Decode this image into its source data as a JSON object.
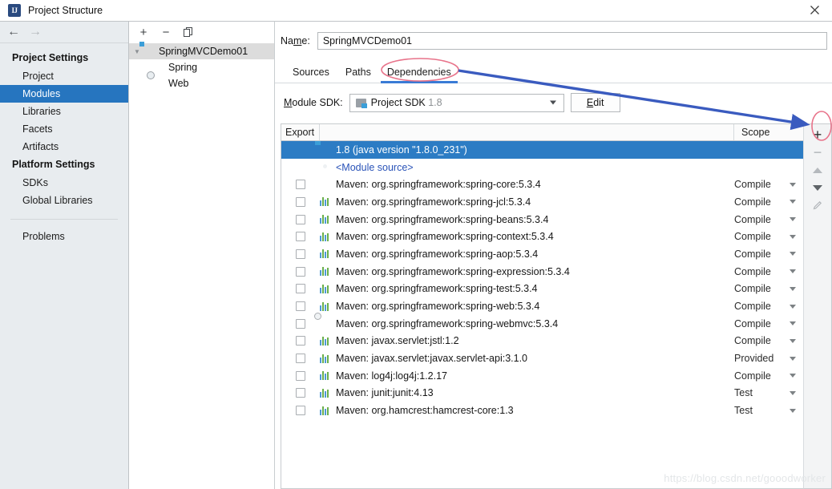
{
  "window": {
    "title": "Project Structure",
    "app_icon": "IJ",
    "close_label": "close-icon"
  },
  "navigation": {
    "back": "←",
    "forward": "→"
  },
  "sidebar": {
    "groups": [
      {
        "heading": "Project Settings",
        "items": [
          {
            "label": "Project",
            "selected": false
          },
          {
            "label": "Modules",
            "selected": true
          },
          {
            "label": "Libraries",
            "selected": false
          },
          {
            "label": "Facets",
            "selected": false
          },
          {
            "label": "Artifacts",
            "selected": false
          }
        ]
      },
      {
        "heading": "Platform Settings",
        "items": [
          {
            "label": "SDKs",
            "selected": false
          },
          {
            "label": "Global Libraries",
            "selected": false
          }
        ]
      }
    ],
    "footer_item": "Problems"
  },
  "module_tree": {
    "toolbar": {
      "add": "+",
      "remove": "−",
      "copy": "❐"
    },
    "nodes": [
      {
        "label": "SpringMVCDemo01",
        "icon": "module-icon",
        "level": 0,
        "selected": true,
        "expanded": true
      },
      {
        "label": "Spring",
        "icon": "spring-leaf-icon",
        "level": 1,
        "selected": false
      },
      {
        "label": "Web",
        "icon": "web-icon",
        "level": 1,
        "selected": false
      }
    ]
  },
  "module_editor": {
    "name_label": "Name:",
    "name_value": "SpringMVCDemo01",
    "tabs": [
      {
        "label": "Sources",
        "active": false
      },
      {
        "label": "Paths",
        "active": false
      },
      {
        "label": "Dependencies",
        "active": true
      }
    ],
    "sdk_label": "Module SDK:",
    "sdk_value": "Project SDK",
    "sdk_value_dim": "1.8",
    "edit_button": "Edit"
  },
  "dependencies_table": {
    "columns": {
      "export": "Export",
      "name": "",
      "scope": "Scope"
    },
    "rows": [
      {
        "checkbox": null,
        "icon": "jdk-icon",
        "label": "1.8 (java version \"1.8.0_231\")",
        "scope": null,
        "selected": true,
        "link": false
      },
      {
        "checkbox": null,
        "icon": "module-source-icon",
        "label": "<Module source>",
        "scope": null,
        "selected": false,
        "link": true
      },
      {
        "checkbox": false,
        "icon": "spring-leaf-icon",
        "label": "Maven: org.springframework:spring-core:5.3.4",
        "scope": "Compile",
        "selected": false,
        "link": false
      },
      {
        "checkbox": false,
        "icon": "library-icon",
        "label": "Maven: org.springframework:spring-jcl:5.3.4",
        "scope": "Compile",
        "selected": false,
        "link": false
      },
      {
        "checkbox": false,
        "icon": "library-icon",
        "label": "Maven: org.springframework:spring-beans:5.3.4",
        "scope": "Compile",
        "selected": false,
        "link": false
      },
      {
        "checkbox": false,
        "icon": "library-icon",
        "label": "Maven: org.springframework:spring-context:5.3.4",
        "scope": "Compile",
        "selected": false,
        "link": false
      },
      {
        "checkbox": false,
        "icon": "library-icon",
        "label": "Maven: org.springframework:spring-aop:5.3.4",
        "scope": "Compile",
        "selected": false,
        "link": false
      },
      {
        "checkbox": false,
        "icon": "library-icon",
        "label": "Maven: org.springframework:spring-expression:5.3.4",
        "scope": "Compile",
        "selected": false,
        "link": false
      },
      {
        "checkbox": false,
        "icon": "library-icon",
        "label": "Maven: org.springframework:spring-test:5.3.4",
        "scope": "Compile",
        "selected": false,
        "link": false
      },
      {
        "checkbox": false,
        "icon": "library-icon",
        "label": "Maven: org.springframework:spring-web:5.3.4",
        "scope": "Compile",
        "selected": false,
        "link": false
      },
      {
        "checkbox": false,
        "icon": "spring-web-icon",
        "label": "Maven: org.springframework:spring-webmvc:5.3.4",
        "scope": "Compile",
        "selected": false,
        "link": false
      },
      {
        "checkbox": false,
        "icon": "library-icon",
        "label": "Maven: javax.servlet:jstl:1.2",
        "scope": "Compile",
        "selected": false,
        "link": false
      },
      {
        "checkbox": false,
        "icon": "library-icon",
        "label": "Maven: javax.servlet:javax.servlet-api:3.1.0",
        "scope": "Provided",
        "selected": false,
        "link": false
      },
      {
        "checkbox": false,
        "icon": "library-icon",
        "label": "Maven: log4j:log4j:1.2.17",
        "scope": "Compile",
        "selected": false,
        "link": false
      },
      {
        "checkbox": false,
        "icon": "library-icon",
        "label": "Maven: junit:junit:4.13",
        "scope": "Test",
        "selected": false,
        "link": false
      },
      {
        "checkbox": false,
        "icon": "library-icon",
        "label": "Maven: org.hamcrest:hamcrest-core:1.3",
        "scope": "Test",
        "selected": false,
        "link": false
      }
    ]
  },
  "table_actions": [
    {
      "name": "add-dependency-button",
      "glyph": "+",
      "enabled": true
    },
    {
      "name": "remove-dependency-button",
      "glyph": "−",
      "enabled": false
    },
    {
      "name": "move-up-button",
      "glyph": "▲",
      "enabled": false
    },
    {
      "name": "move-down-button",
      "glyph": "▼",
      "enabled": true
    },
    {
      "name": "edit-dependency-button",
      "glyph": "✎",
      "enabled": false
    }
  ],
  "annotations": {
    "highlight_color": "#e8738a",
    "arrow_color": "#3a5bbf",
    "circle_target_tab": "Dependencies",
    "circle_target_button": "+"
  },
  "watermark": {
    "text": "https://blog.csdn.net/gooodworker",
    "color": "#e3e6e8"
  }
}
